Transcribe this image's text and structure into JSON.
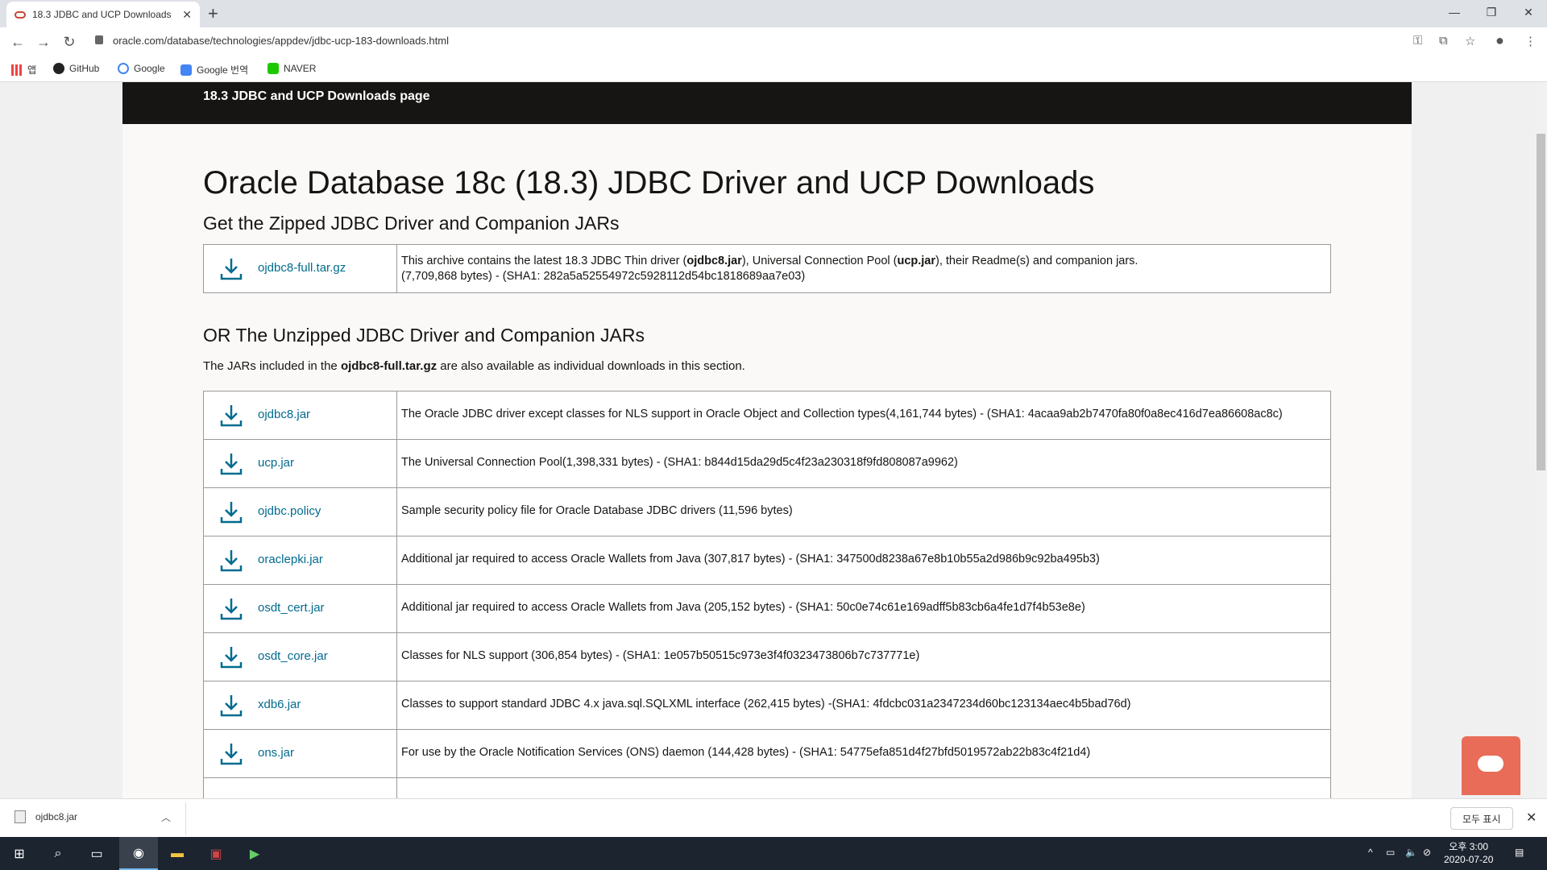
{
  "browser": {
    "tab_title": "18.3 JDBC and UCP Downloads",
    "url": "oracle.com/database/technologies/appdev/jdbc-ucp-183-downloads.html",
    "bookmarks": [
      "앱",
      "GitHub",
      "Google",
      "Google 번역",
      "NAVER"
    ]
  },
  "page": {
    "banner": "18.3 JDBC and UCP Downloads page",
    "title": "Oracle Database 18c (18.3) JDBC Driver and UCP Downloads",
    "section1": "Get the Zipped JDBC Driver and Companion JARs",
    "zipped": {
      "file": "ojdbc8-full.tar.gz",
      "desc_pre": "This archive contains the latest 18.3 JDBC Thin driver (",
      "desc_b1": "ojdbc8.jar",
      "desc_mid": "), Universal Connection Pool (",
      "desc_b2": "ucp.jar",
      "desc_post": "), their Readme(s) and companion jars.",
      "desc_line2": "(7,709,868 bytes) - (SHA1: 282a5a52554972c5928112d54bc1818689aa7e03)"
    },
    "section2": "OR The Unzipped JDBC Driver and Companion JARs",
    "intro_pre": "The JARs included in the ",
    "intro_bold": "ojdbc8-full.tar.gz",
    "intro_post": " are also available as individual downloads in this section.",
    "files": [
      {
        "name": "ojdbc8.jar",
        "desc": "The Oracle JDBC driver except classes for NLS support in Oracle Object and Collection types(4,161,744 bytes) - (SHA1: 4acaa9ab2b7470fa80f0a8ec416d7ea86608ac8c)"
      },
      {
        "name": "ucp.jar",
        "desc": "The Universal Connection Pool(1,398,331 bytes) - (SHA1: b844d15da29d5c4f23a230318f9fd808087a9962)"
      },
      {
        "name": "ojdbc.policy",
        "desc": "Sample security policy file for Oracle Database JDBC drivers (11,596 bytes)"
      },
      {
        "name": "oraclepki.jar",
        "desc": "Additional jar required to access Oracle Wallets from Java (307,817 bytes) - (SHA1: 347500d8238a67e8b10b55a2d986b9c92ba495b3)"
      },
      {
        "name": "osdt_cert.jar",
        "desc": "Additional jar required to access Oracle Wallets from Java (205,152 bytes) - (SHA1: 50c0e74c61e169adff5b83cb6a4fe1d7f4b53e8e)"
      },
      {
        "name": "osdt_core.jar",
        "desc": "Classes for NLS support (306,854 bytes) - (SHA1: 1e057b50515c973e3f4f0323473806b7c737771e)"
      },
      {
        "name": "xdb6.jar",
        "desc": "Classes to support standard JDBC 4.x java.sql.SQLXML interface (262,415 bytes) -(SHA1: 4fdcbc031a2347234d60bc123134aec4b5bad76d)"
      },
      {
        "name": "ons.jar",
        "desc": "For use by the Oracle Notification Services (ONS) daemon (144,428 bytes) - (SHA1: 54775efa851d4f27bfd5019572ab22b83c4f21d4)"
      }
    ]
  },
  "download_shelf": {
    "file": "ojdbc8.jar",
    "show_all": "모두 표시"
  },
  "taskbar": {
    "time": "오후 3:00",
    "date": "2020-07-20"
  },
  "colors": {
    "link": "#006b8f",
    "banner": "#161513",
    "chat": "#e86c57"
  }
}
